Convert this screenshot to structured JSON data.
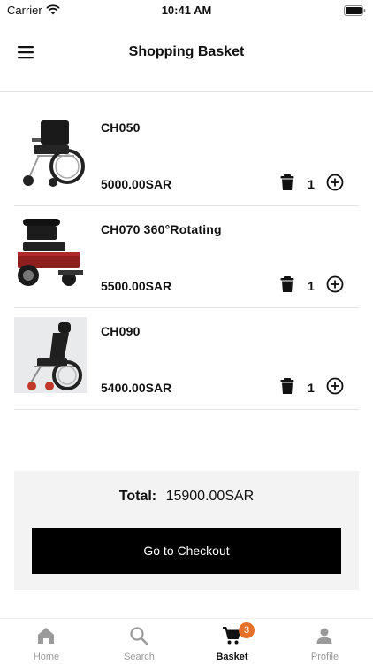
{
  "status_bar": {
    "carrier": "Carrier",
    "time": "10:41 AM"
  },
  "header": {
    "title": "Shopping Basket",
    "menu_icon": "hamburger-menu-icon"
  },
  "basket": {
    "items": [
      {
        "name": "CH050",
        "price": "5000.00SAR",
        "quantity": "1",
        "image": "folding-wheelchair-black"
      },
      {
        "name": "CH070 360°Rotating",
        "price": "5500.00SAR",
        "quantity": "1",
        "image": "rotating-wheelchair-red"
      },
      {
        "name": "CH090",
        "price": "5400.00SAR",
        "quantity": "1",
        "image": "reclining-wheelchair"
      }
    ]
  },
  "summary": {
    "total_label": "Total:",
    "total_value": "15900.00SAR",
    "checkout_label": "Go to Checkout"
  },
  "tabs": [
    {
      "label": "Home",
      "icon": "home-icon",
      "active": false
    },
    {
      "label": "Search",
      "icon": "search-icon",
      "active": false
    },
    {
      "label": "Basket",
      "icon": "cart-icon",
      "active": true,
      "badge": "3"
    },
    {
      "label": "Profile",
      "icon": "profile-icon",
      "active": false
    }
  ],
  "colors": {
    "accent": "#e4702a",
    "checkout_bg": "#000000",
    "summary_bg": "#f3f3f3",
    "inactive_tab": "#9a9a9a"
  }
}
